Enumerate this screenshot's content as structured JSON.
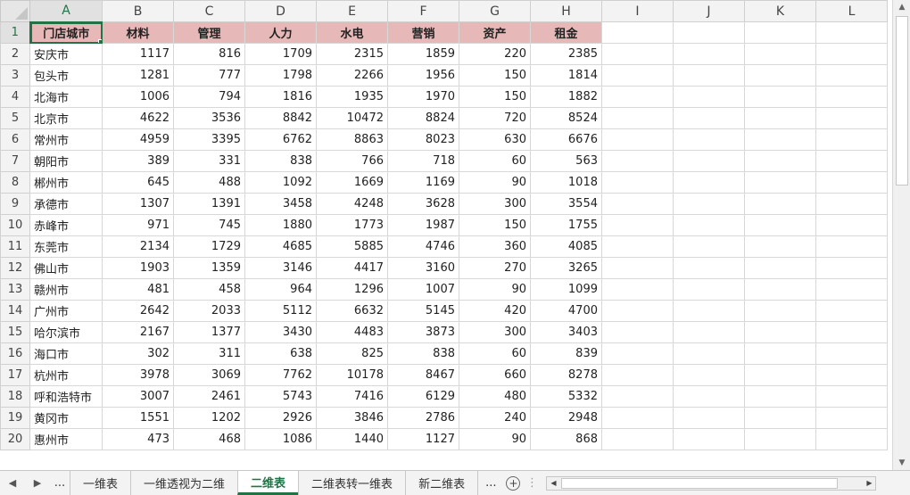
{
  "columns": [
    "A",
    "B",
    "C",
    "D",
    "E",
    "F",
    "G",
    "H",
    "I",
    "J",
    "K",
    "L"
  ],
  "header_row": [
    "门店城市",
    "材料",
    "管理",
    "人力",
    "水电",
    "营销",
    "资产",
    "租金"
  ],
  "rows": [
    [
      "2",
      "安庆市",
      "1117",
      "816",
      "1709",
      "2315",
      "1859",
      "220",
      "2385"
    ],
    [
      "3",
      "包头市",
      "1281",
      "777",
      "1798",
      "2266",
      "1956",
      "150",
      "1814"
    ],
    [
      "4",
      "北海市",
      "1006",
      "794",
      "1816",
      "1935",
      "1970",
      "150",
      "1882"
    ],
    [
      "5",
      "北京市",
      "4622",
      "3536",
      "8842",
      "10472",
      "8824",
      "720",
      "8524"
    ],
    [
      "6",
      "常州市",
      "4959",
      "3395",
      "6762",
      "8863",
      "8023",
      "630",
      "6676"
    ],
    [
      "7",
      "朝阳市",
      "389",
      "331",
      "838",
      "766",
      "718",
      "60",
      "563"
    ],
    [
      "8",
      "郴州市",
      "645",
      "488",
      "1092",
      "1669",
      "1169",
      "90",
      "1018"
    ],
    [
      "9",
      "承德市",
      "1307",
      "1391",
      "3458",
      "4248",
      "3628",
      "300",
      "3554"
    ],
    [
      "10",
      "赤峰市",
      "971",
      "745",
      "1880",
      "1773",
      "1987",
      "150",
      "1755"
    ],
    [
      "11",
      "东莞市",
      "2134",
      "1729",
      "4685",
      "5885",
      "4746",
      "360",
      "4085"
    ],
    [
      "12",
      "佛山市",
      "1903",
      "1359",
      "3146",
      "4417",
      "3160",
      "270",
      "3265"
    ],
    [
      "13",
      "赣州市",
      "481",
      "458",
      "964",
      "1296",
      "1007",
      "90",
      "1099"
    ],
    [
      "14",
      "广州市",
      "2642",
      "2033",
      "5112",
      "6632",
      "5145",
      "420",
      "4700"
    ],
    [
      "15",
      "哈尔滨市",
      "2167",
      "1377",
      "3430",
      "4483",
      "3873",
      "300",
      "3403"
    ],
    [
      "16",
      "海口市",
      "302",
      "311",
      "638",
      "825",
      "838",
      "60",
      "839"
    ],
    [
      "17",
      "杭州市",
      "3978",
      "3069",
      "7762",
      "10178",
      "8467",
      "660",
      "8278"
    ],
    [
      "18",
      "呼和浩特市",
      "3007",
      "2461",
      "5743",
      "7416",
      "6129",
      "480",
      "5332"
    ],
    [
      "19",
      "黄冈市",
      "1551",
      "1202",
      "2926",
      "3846",
      "2786",
      "240",
      "2948"
    ],
    [
      "20",
      "惠州市",
      "473",
      "468",
      "1086",
      "1440",
      "1127",
      "90",
      "868"
    ]
  ],
  "tabs": {
    "dots_left": "...",
    "sheets": [
      "一维表",
      "一维透视为二维",
      "二维表",
      "二维表转一维表",
      "新二维表"
    ],
    "active_index": 2,
    "dots_right": "..."
  },
  "theme": {
    "accent": "#217346",
    "header_fill": "#e6b8b7"
  }
}
